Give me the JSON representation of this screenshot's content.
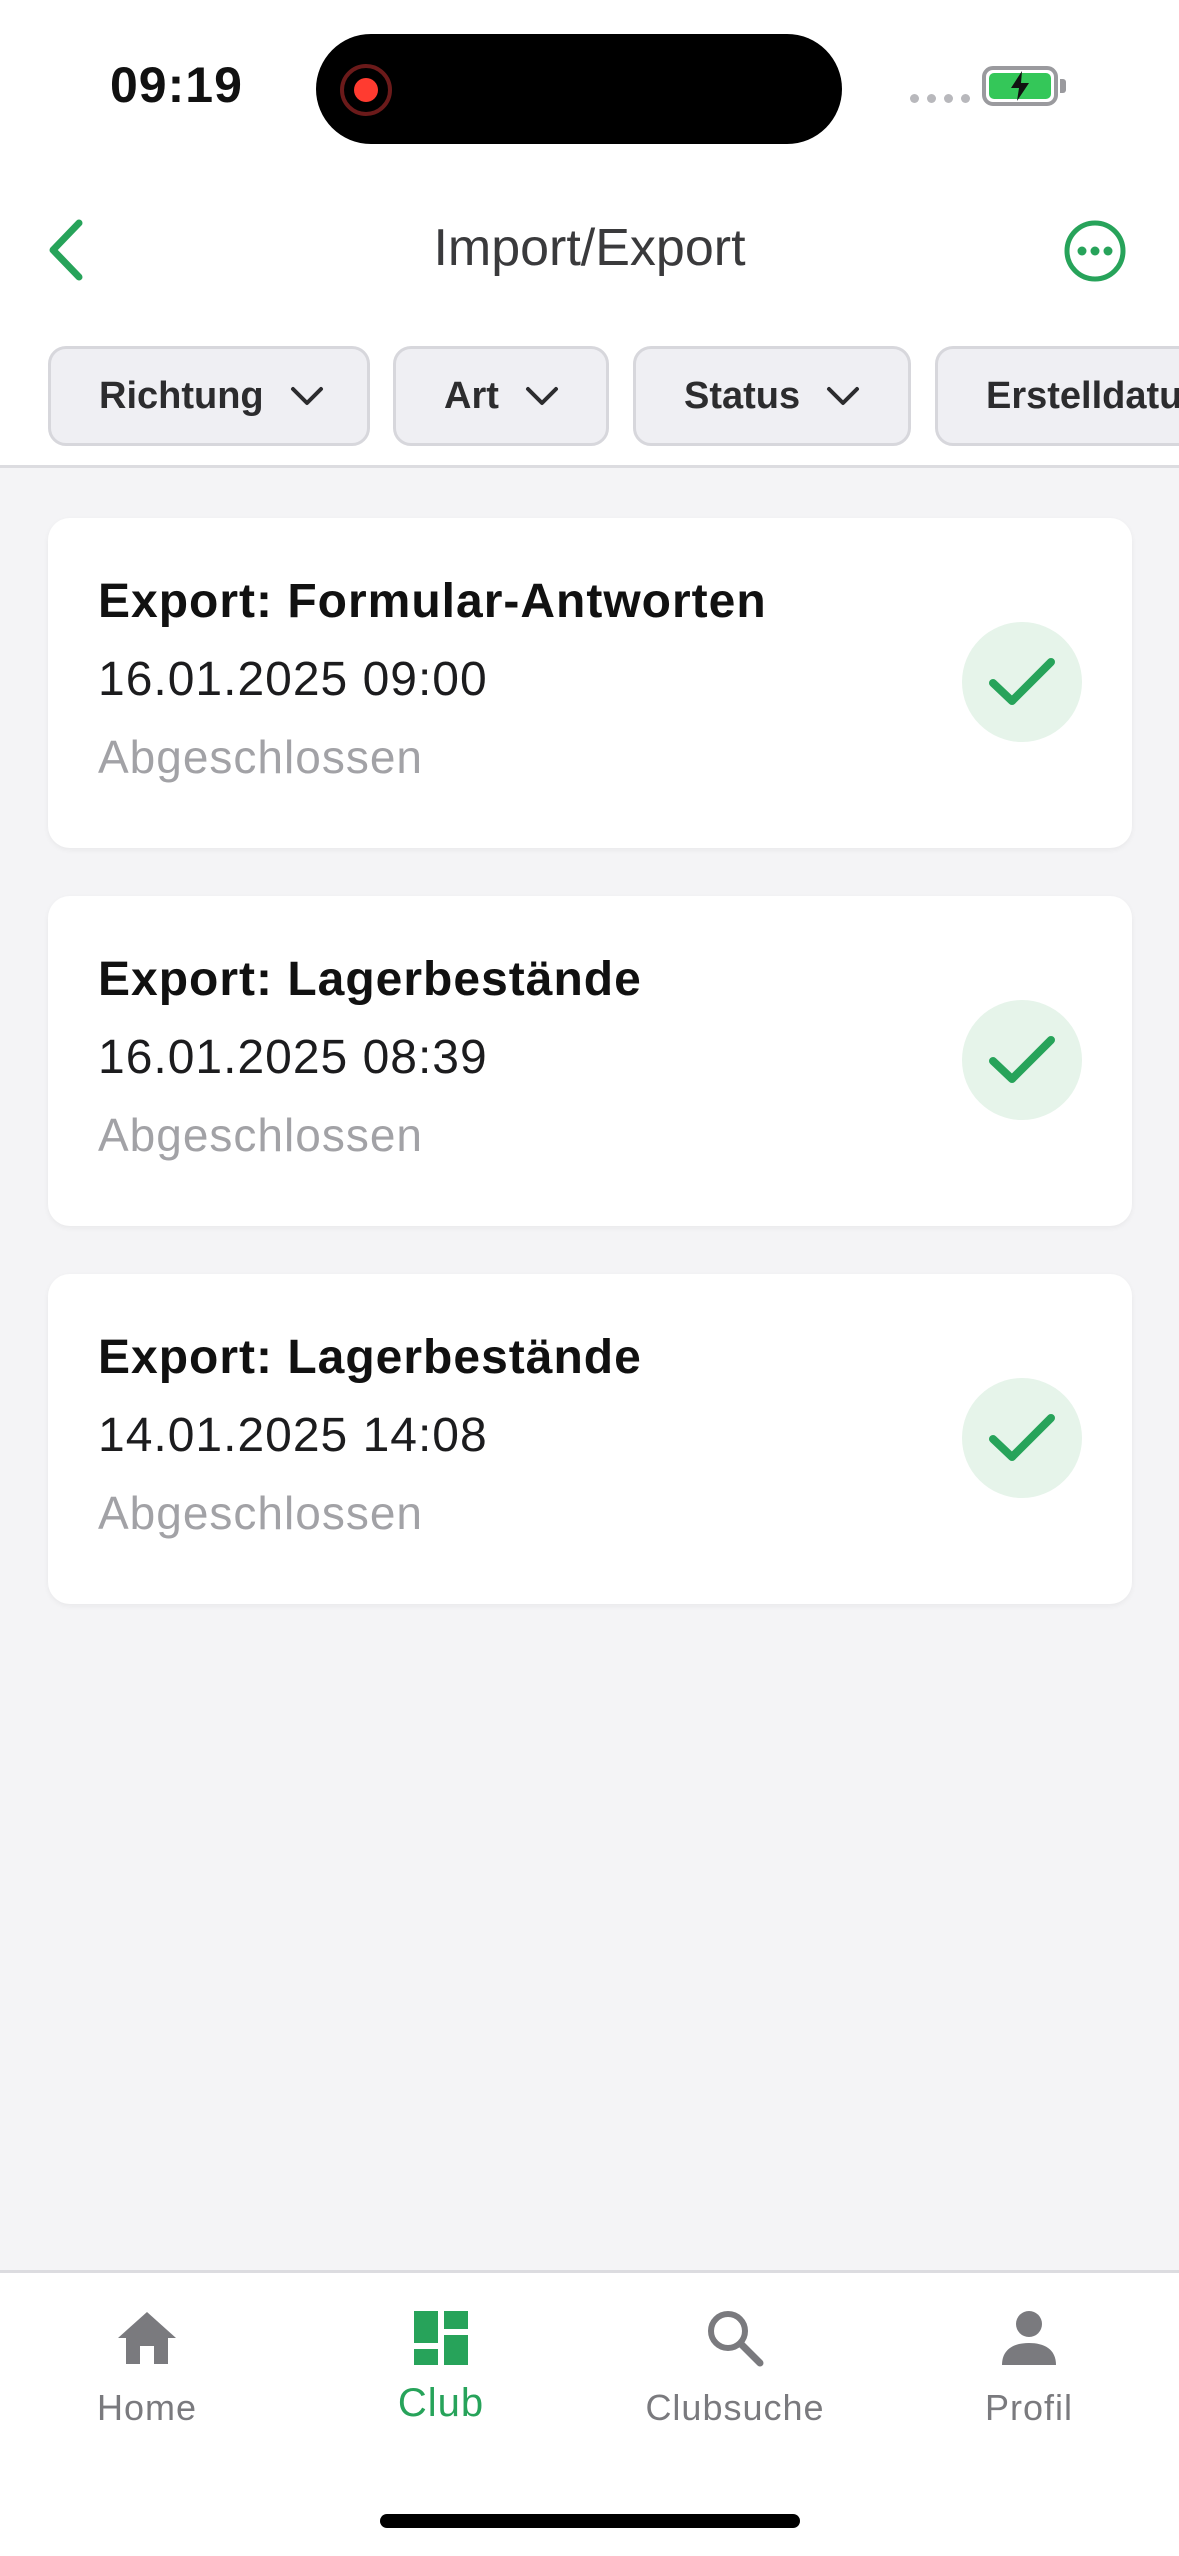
{
  "status_bar": {
    "time": "09:19"
  },
  "header": {
    "title": "Import/Export",
    "back_icon": "chevron-left-icon",
    "more_icon": "more-horizontal-circle-icon"
  },
  "filters": [
    {
      "label": "Richtung"
    },
    {
      "label": "Art"
    },
    {
      "label": "Status"
    },
    {
      "label": "Erstelldatum"
    }
  ],
  "items": [
    {
      "title": "Export: Formular-Antworten",
      "date": "16.01.2025 09:00",
      "status": "Abgeschlossen"
    },
    {
      "title": "Export: Lagerbestände",
      "date": "16.01.2025 08:39",
      "status": "Abgeschlossen"
    },
    {
      "title": "Export: Lagerbestände",
      "date": "14.01.2025 14:08",
      "status": "Abgeschlossen"
    }
  ],
  "tabs": [
    {
      "label": "Home",
      "icon": "home-icon"
    },
    {
      "label": "Club",
      "icon": "dashboard-icon",
      "active": true
    },
    {
      "label": "Clubsuche",
      "icon": "search-icon"
    },
    {
      "label": "Profil",
      "icon": "person-icon"
    }
  ],
  "colors": {
    "accent": "#27a35a",
    "success_bg": "#e6f4ea",
    "muted_text": "#a2a2a6",
    "background": "#f4f4f6"
  }
}
